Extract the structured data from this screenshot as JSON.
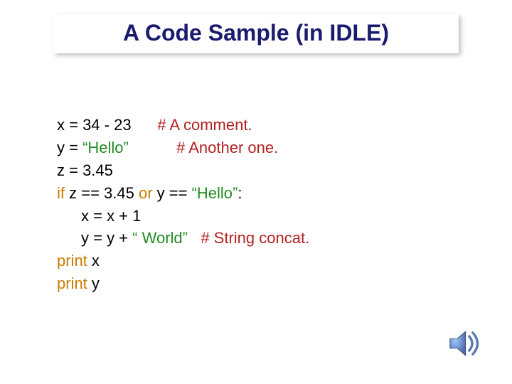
{
  "title": "A Code Sample (in IDLE)",
  "code": {
    "l1": {
      "a": "x = 34 - 23",
      "cm": "# A comment."
    },
    "l2": {
      "a": "y = ",
      "str": "“Hello”",
      "cm": "# Another one."
    },
    "l3": {
      "a": "z = 3.45"
    },
    "l4": {
      "k1": "if",
      "a": " z == 3.45 ",
      "k2": "or",
      "b": " y == ",
      "str": "“Hello”",
      "c": ":"
    },
    "l5": {
      "a": "x = x + 1"
    },
    "l6": {
      "a": "y = y + ",
      "str": "“ World”",
      "cm": "# String concat."
    },
    "l7": {
      "k": "print",
      "a": " x"
    },
    "l8": {
      "k": "print",
      "a": " y"
    }
  }
}
